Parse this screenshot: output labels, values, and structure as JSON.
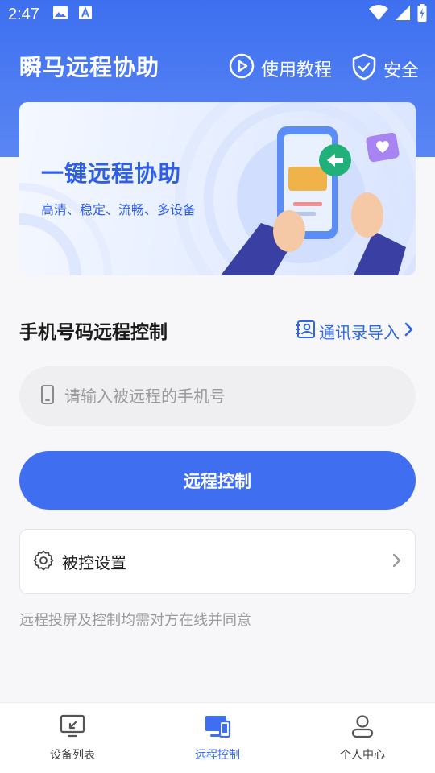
{
  "status_bar": {
    "time": "2:47"
  },
  "header": {
    "title": "瞬马远程协助",
    "tutorial_label": "使用教程",
    "security_label": "安全"
  },
  "banner": {
    "title": "一键远程协助",
    "subtitle": "高清、稳定、流畅、多设备"
  },
  "phone_section": {
    "title": "手机号码远程控制",
    "import_label": "通讯录导入",
    "input_placeholder": "请输入被远程的手机号",
    "input_value": "",
    "submit_label": "远程控制"
  },
  "settings": {
    "label": "被控设置"
  },
  "note": "远程投屏及控制均需对方在线并同意",
  "tabs": [
    {
      "label": "设备列表",
      "icon": "monitor-arrow-icon",
      "active": false
    },
    {
      "label": "远程控制",
      "icon": "devices-icon",
      "active": true
    },
    {
      "label": "个人中心",
      "icon": "person-icon",
      "active": false
    }
  ],
  "colors": {
    "primary": "#3f6ff0",
    "header_gradient_top": "#3d6ff0",
    "header_gradient_bottom": "#5a86f3",
    "background": "#f7f7f9",
    "muted_text": "#9a9a9e"
  }
}
